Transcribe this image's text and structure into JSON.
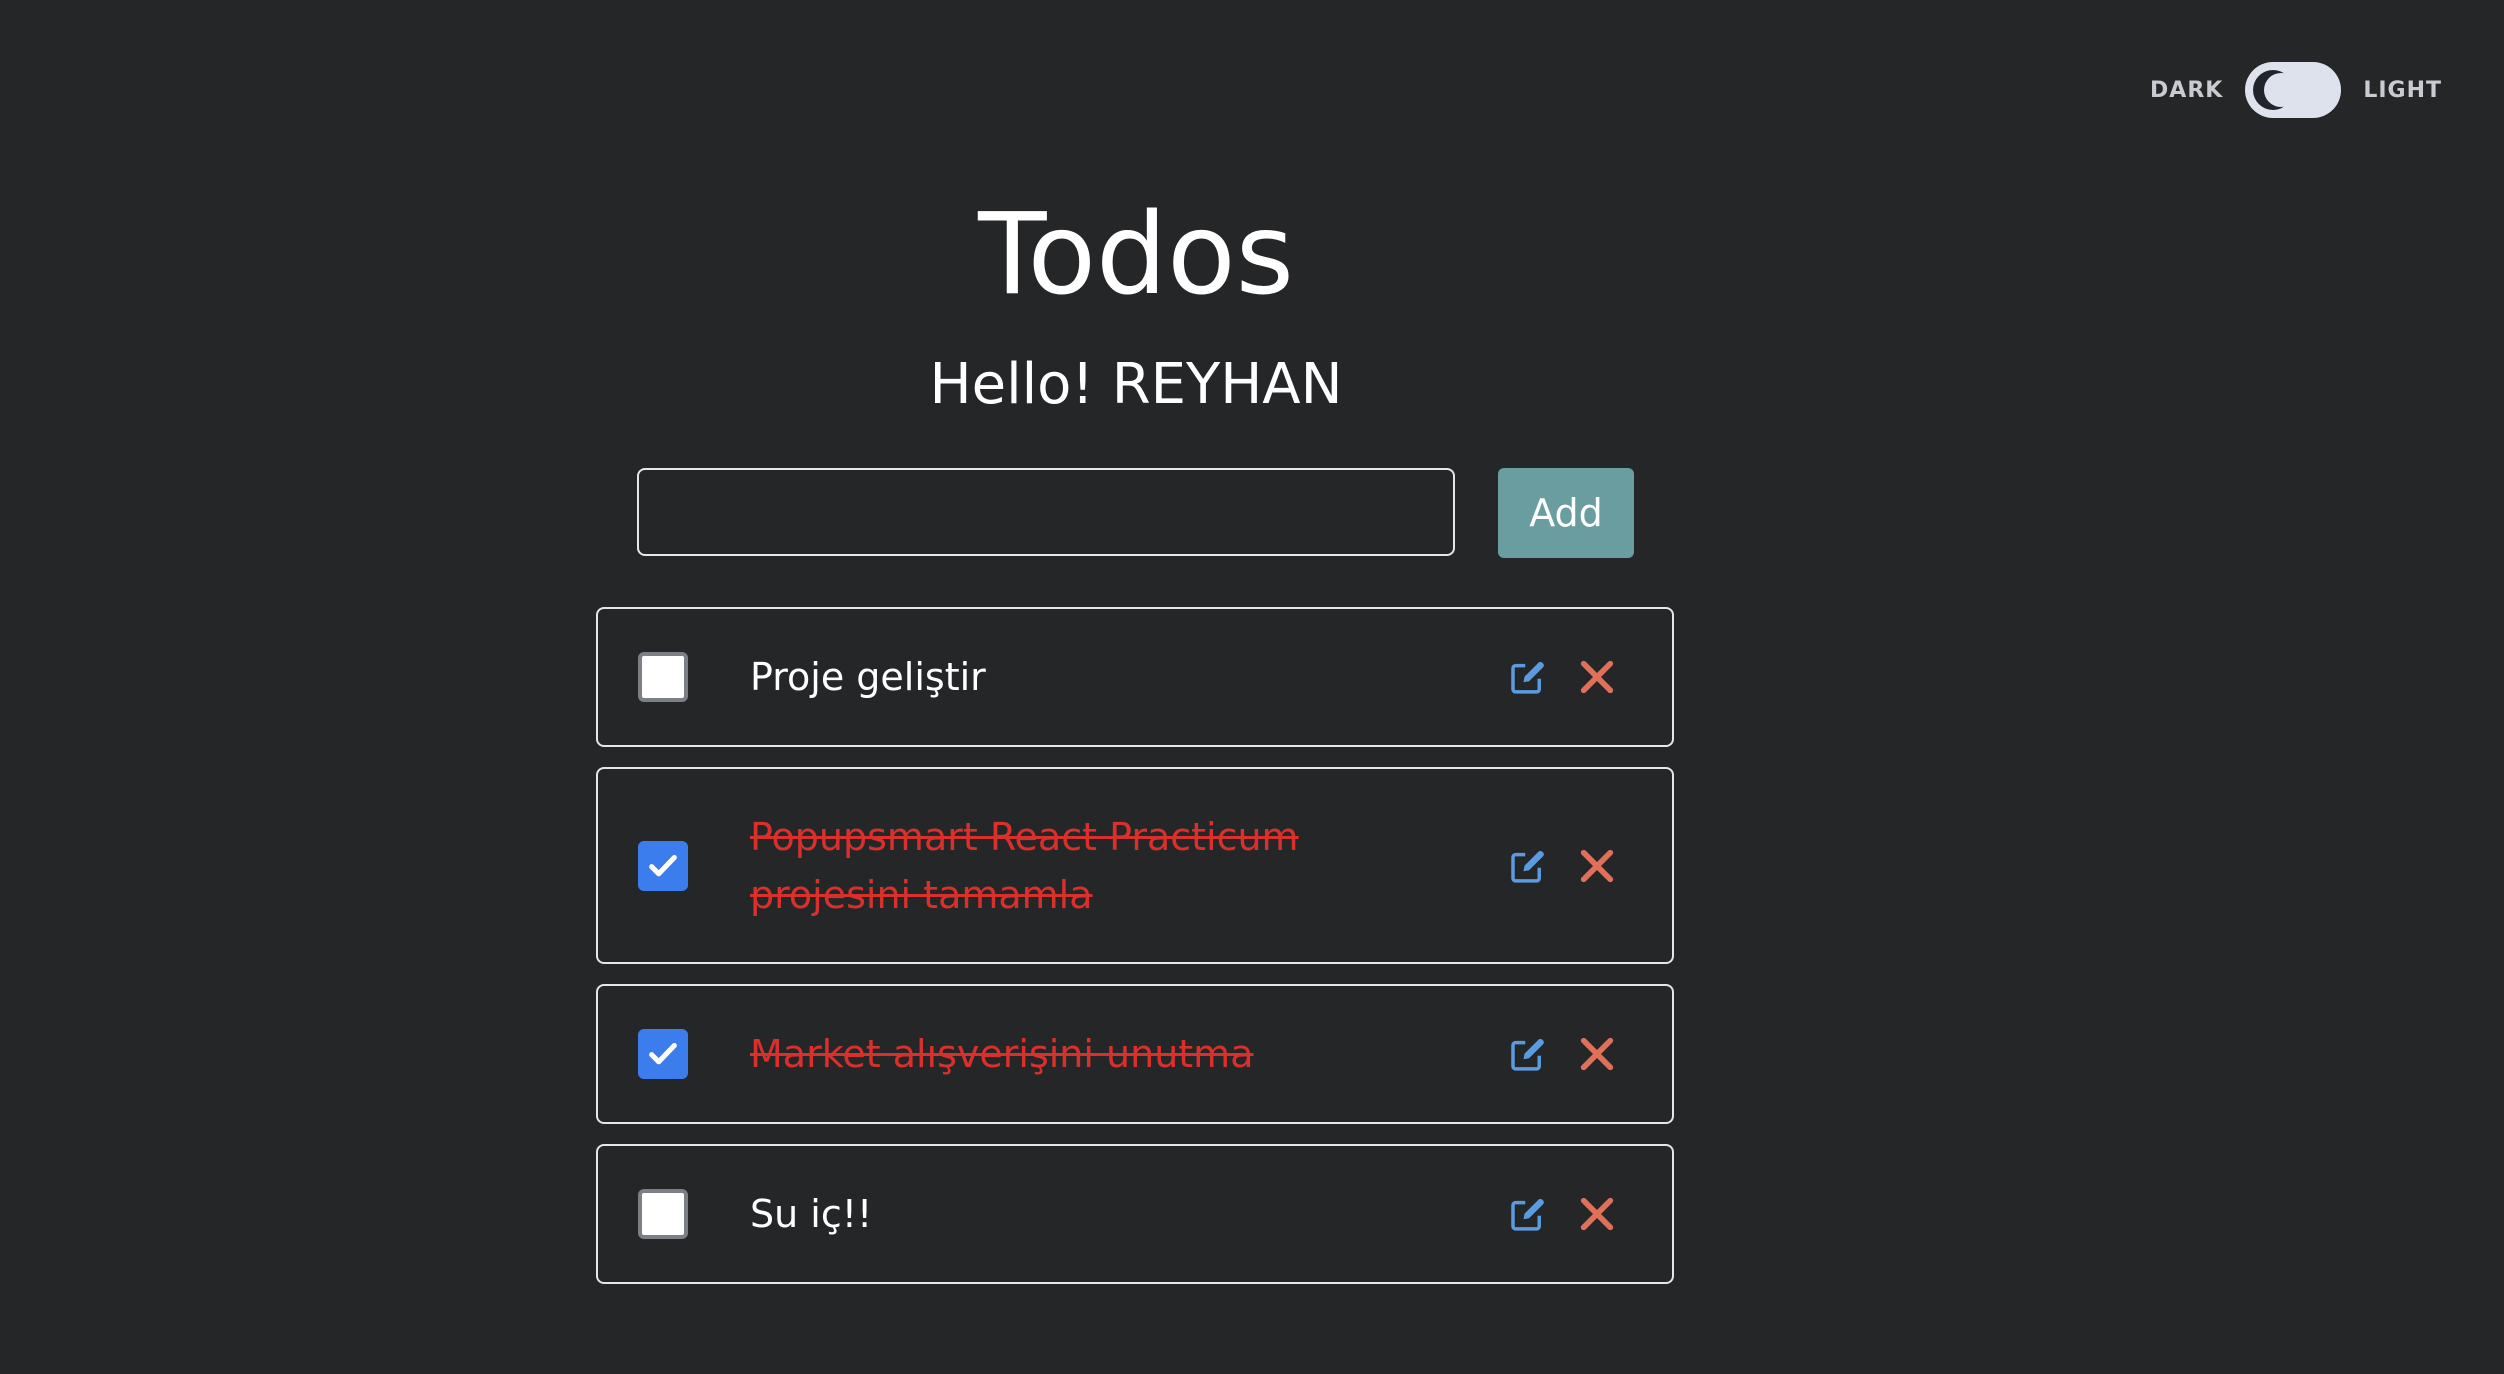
{
  "theme_toggle": {
    "dark_label": "DARK",
    "light_label": "LIGHT",
    "mode": "dark"
  },
  "header": {
    "title": "Todos",
    "greeting": "Hello! REYHAN"
  },
  "new_todo": {
    "value": "",
    "placeholder": "",
    "add_label": "Add"
  },
  "todos": [
    {
      "text": "Proje geliştir",
      "completed": false
    },
    {
      "text": "Popupsmart React Practicum projesini tamamla",
      "completed": true
    },
    {
      "text": "Market alışverişini unutma",
      "completed": true
    },
    {
      "text": "Su iç!!",
      "completed": false
    }
  ],
  "icons": {
    "edit": "edit-icon",
    "delete": "close-icon",
    "check": "check-icon"
  },
  "colors": {
    "background": "#252628",
    "add_button": "#6a9d9f",
    "checkbox_checked": "#3b7ded",
    "completed_text": "#d9302c",
    "edit_icon": "#5b9be0",
    "delete_icon": "#e0705a"
  }
}
